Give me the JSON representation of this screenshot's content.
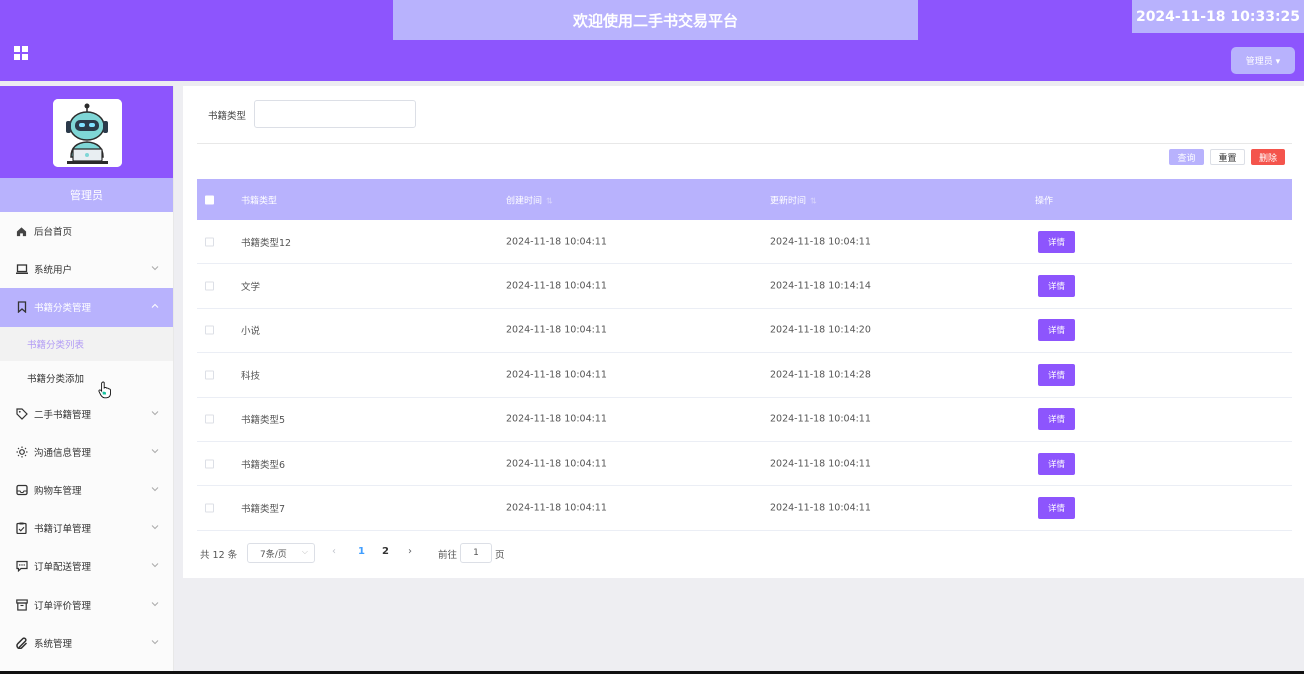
{
  "header": {
    "title": "欢迎使用二手书交易平台",
    "clock": "2024-11-18 10:33:25",
    "user_menu": "管理员 ▾"
  },
  "sidebar": {
    "role": "管理员",
    "items": [
      {
        "label": "后台首页",
        "icon": "home-icon"
      },
      {
        "label": "系统用户",
        "icon": "laptop-icon"
      },
      {
        "label": "书籍分类管理",
        "icon": "bookmark-icon"
      },
      {
        "label": "二手书籍管理",
        "icon": "tag-icon"
      },
      {
        "label": "沟通信息管理",
        "icon": "sun-icon"
      },
      {
        "label": "购物车管理",
        "icon": "inbox-icon"
      },
      {
        "label": "书籍订单管理",
        "icon": "clipboard-icon"
      },
      {
        "label": "订单配送管理",
        "icon": "message-icon"
      },
      {
        "label": "订单评价管理",
        "icon": "archive-icon"
      },
      {
        "label": "系统管理",
        "icon": "paperclip-icon"
      }
    ],
    "sub_items": [
      "书籍分类列表",
      "书籍分类添加"
    ]
  },
  "search": {
    "label": "书籍类型",
    "value": ""
  },
  "toolbar": {
    "query": "查询",
    "reset": "重置",
    "delete": "删除"
  },
  "table": {
    "headers": {
      "type": "书籍类型",
      "created": "创建时间",
      "updated": "更新时间",
      "operation": "操作"
    },
    "rows": [
      {
        "type": "书籍类型12",
        "created": "2024-11-18 10:04:11",
        "updated": "2024-11-18 10:04:11",
        "action": "详情"
      },
      {
        "type": "文学",
        "created": "2024-11-18 10:04:11",
        "updated": "2024-11-18 10:14:14",
        "action": "详情"
      },
      {
        "type": "小说",
        "created": "2024-11-18 10:04:11",
        "updated": "2024-11-18 10:14:20",
        "action": "详情"
      },
      {
        "type": "科技",
        "created": "2024-11-18 10:04:11",
        "updated": "2024-11-18 10:14:28",
        "action": "详情"
      },
      {
        "type": "书籍类型5",
        "created": "2024-11-18 10:04:11",
        "updated": "2024-11-18 10:04:11",
        "action": "详情"
      },
      {
        "type": "书籍类型6",
        "created": "2024-11-18 10:04:11",
        "updated": "2024-11-18 10:04:11",
        "action": "详情"
      },
      {
        "type": "书籍类型7",
        "created": "2024-11-18 10:04:11",
        "updated": "2024-11-18 10:04:11",
        "action": "详情"
      }
    ]
  },
  "pagination": {
    "total": "共 12 条",
    "page_size": "7条/页",
    "pages": [
      "1",
      "2"
    ],
    "goto_label": "前往",
    "goto_value": "1",
    "page_unit": "页"
  },
  "colors": {
    "primary": "#8d55fd",
    "light": "#b8b2fd",
    "danger": "#f4544c"
  }
}
